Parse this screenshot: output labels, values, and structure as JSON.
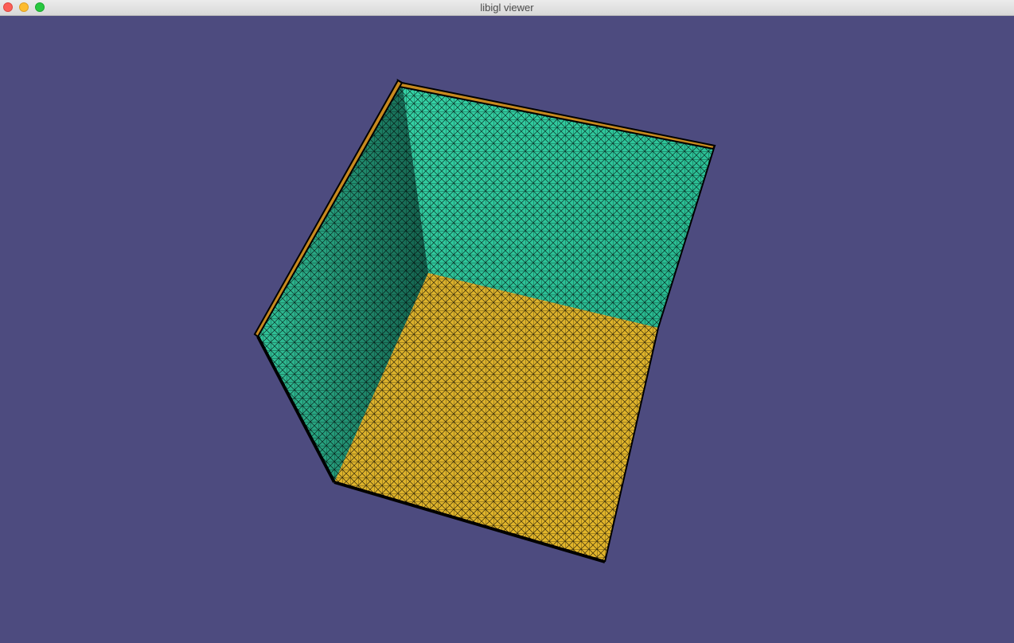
{
  "window": {
    "title": "libigl viewer",
    "background_color": "#4d4b7f"
  },
  "controls": {
    "close": "close-button",
    "minimize": "minimize-button",
    "maximize": "maximize-button"
  },
  "mesh": {
    "wall_color": "#2fc49a",
    "floor_color": "#d9b02a",
    "edge_color": "#000000"
  }
}
